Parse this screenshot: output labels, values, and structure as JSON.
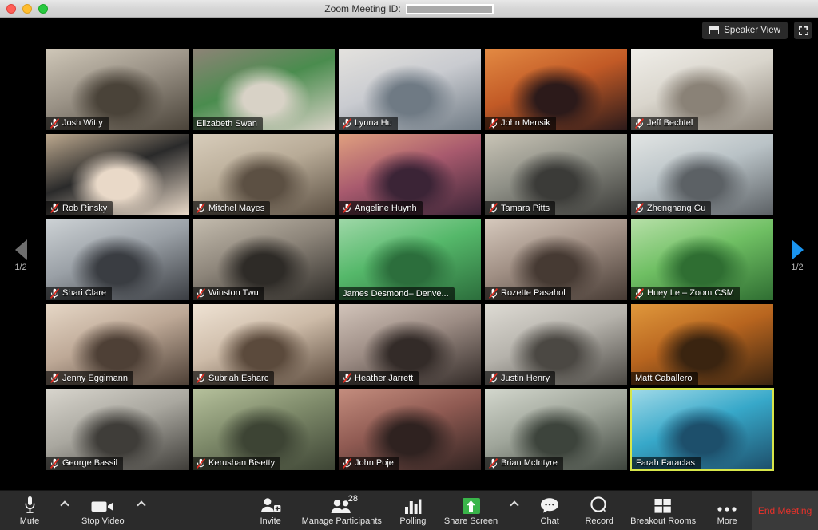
{
  "window": {
    "title_label": "Zoom Meeting ID:",
    "meeting_id_redacted": "",
    "traffic_lights": [
      "close-red",
      "minimize-yellow",
      "maximize-green"
    ]
  },
  "topbar": {
    "view_button_label": "Speaker View",
    "view_button_icon": "window-icon",
    "fullscreen_icon": "fullscreen-expand-icon"
  },
  "pagination": {
    "prev_label": "1/2",
    "next_label": "1/2",
    "prev_icon": "triangle-left-icon",
    "next_icon": "triangle-right-icon",
    "prev_color": "#6e6e6e",
    "next_color": "#1a94ef"
  },
  "gallery": {
    "columns": 5,
    "rows": 5,
    "active_speaker": "Farah Faraclas",
    "active_border_color": "#d6e64a",
    "participants": [
      {
        "name": "Josh Witty",
        "muted": true,
        "bg": "office-man-beard",
        "c1": "#9a9286",
        "c2": "#4a4339",
        "c3": "#cfc7b8"
      },
      {
        "name": "Elizabeth Swan",
        "muted": false,
        "bg": "office-green-wall",
        "c1": "#4a8c4e",
        "c2": "#d8d2c6",
        "c3": "#8e8377"
      },
      {
        "name": "Lynna Hu",
        "muted": true,
        "bg": "office-woman-window",
        "c1": "#c9cbd0",
        "c2": "#6f7a84",
        "c3": "#e4e2de"
      },
      {
        "name": "John Mensik",
        "muted": true,
        "bg": "sunset-bridge",
        "c1": "#c25a26",
        "c2": "#2c1a1a",
        "c3": "#e38a43"
      },
      {
        "name": "Jeff Bechtel",
        "muted": true,
        "bg": "office-bright",
        "c1": "#d9d5cc",
        "c2": "#8a8277",
        "c3": "#f0eee9"
      },
      {
        "name": "Rob Rinsky",
        "muted": true,
        "bg": "baby-on-screen",
        "c1": "#2a2a2a",
        "c2": "#e9d9c8",
        "c3": "#bda98f"
      },
      {
        "name": "Mitchel Mayes",
        "muted": true,
        "bg": "office-two-people",
        "c1": "#b8ab97",
        "c2": "#5c5043",
        "c3": "#d8cdbb"
      },
      {
        "name": "Angeline Huynh",
        "muted": true,
        "bg": "lighthouse-sunset",
        "c1": "#a85a6e",
        "c2": "#3b2436",
        "c3": "#e0a07f"
      },
      {
        "name": "Tamara Pitts",
        "muted": true,
        "bg": "home-woman",
        "c1": "#8e8f86",
        "c2": "#3b3b38",
        "c3": "#c9c4b6"
      },
      {
        "name": "Zhenghang Gu",
        "muted": true,
        "bg": "office-man-headset",
        "c1": "#b9c2c6",
        "c2": "#5c6165",
        "c3": "#e2e5e4"
      },
      {
        "name": "Shari Clare",
        "muted": true,
        "bg": "office-desk-woman",
        "c1": "#9aa0a6",
        "c2": "#3a3d42",
        "c3": "#cdd2d5"
      },
      {
        "name": "Winston Twu",
        "muted": true,
        "bg": "office-man-suit",
        "c1": "#8d857a",
        "c2": "#2e2b27",
        "c3": "#c4bcae"
      },
      {
        "name": "James Desmond– Denve...",
        "muted": false,
        "bg": "green-screen-man",
        "c1": "#55b86a",
        "c2": "#2c6e3c",
        "c3": "#9fd8a8"
      },
      {
        "name": "Rozette Pasahol",
        "muted": true,
        "bg": "office-woman-glasses",
        "c1": "#a08f84",
        "c2": "#463a33",
        "c3": "#d6c9bd"
      },
      {
        "name": "Huey Le – Zoom CSM",
        "muted": true,
        "bg": "green-wall-man",
        "c1": "#6fbf63",
        "c2": "#2f6e32",
        "c3": "#b7e0a8"
      },
      {
        "name": "Jenny Eggimann",
        "muted": true,
        "bg": "home-woman-smiling",
        "c1": "#bda896",
        "c2": "#4e4036",
        "c3": "#e6d7c6"
      },
      {
        "name": "Subriah Esharc",
        "muted": true,
        "bg": "indoor-woman",
        "c1": "#cdbba8",
        "c2": "#5b4a3c",
        "c3": "#efe3d4"
      },
      {
        "name": "Heather Jarrett",
        "muted": true,
        "bg": "car-woman",
        "c1": "#9c8c84",
        "c2": "#332b28",
        "c3": "#d2c4ba"
      },
      {
        "name": "Justin Henry",
        "muted": true,
        "bg": "office-man-desk",
        "c1": "#b5b2ab",
        "c2": "#4b4843",
        "c3": "#dedbd4"
      },
      {
        "name": "Matt Caballero",
        "muted": false,
        "bg": "autumn-forest",
        "c1": "#b8651f",
        "c2": "#3a2410",
        "c3": "#e0983c"
      },
      {
        "name": "George Bassil",
        "muted": true,
        "bg": "office-man-shirt",
        "c1": "#a9a79f",
        "c2": "#3f3d39",
        "c3": "#d8d5cd"
      },
      {
        "name": "Kerushan Bisetty",
        "muted": true,
        "bg": "backyard-pool",
        "c1": "#7e8a6a",
        "c2": "#3d4434",
        "c3": "#b6c19c"
      },
      {
        "name": "John Poje",
        "muted": true,
        "bg": "office-man-red",
        "c1": "#8f5a52",
        "c2": "#2f2220",
        "c3": "#c48d7e"
      },
      {
        "name": "Brian McIntyre",
        "muted": true,
        "bg": "office-green-chair",
        "c1": "#9fa59a",
        "c2": "#3d443c",
        "c3": "#d3d7cd"
      },
      {
        "name": "Farah Faraclas",
        "muted": false,
        "bg": "mountain-lake-virtual",
        "c1": "#37a8c9",
        "c2": "#1d4f6b",
        "c3": "#9fd9e8"
      }
    ]
  },
  "toolbar": {
    "mute": {
      "label": "Mute",
      "icon": "microphone-icon"
    },
    "audio_options_icon": "chevron-up-icon",
    "stop_video": {
      "label": "Stop Video",
      "icon": "camera-icon"
    },
    "video_options_icon": "chevron-up-icon",
    "invite": {
      "label": "Invite",
      "icon": "person-add-icon"
    },
    "manage_participants": {
      "label": "Manage Participants",
      "icon": "people-icon",
      "count": "28"
    },
    "polling": {
      "label": "Polling",
      "icon": "bar-chart-icon"
    },
    "share_screen": {
      "label": "Share Screen",
      "icon": "share-up-arrow-icon",
      "accent": "#3ab54a"
    },
    "share_options_icon": "chevron-up-icon",
    "chat": {
      "label": "Chat",
      "icon": "chat-bubble-icon"
    },
    "record": {
      "label": "Record",
      "icon": "record-circle-icon"
    },
    "breakout_rooms": {
      "label": "Breakout Rooms",
      "icon": "grid-squares-icon"
    },
    "more": {
      "label": "More",
      "icon": "ellipsis-icon"
    },
    "end_meeting": {
      "label": "End Meeting",
      "color": "#e8312a"
    }
  }
}
